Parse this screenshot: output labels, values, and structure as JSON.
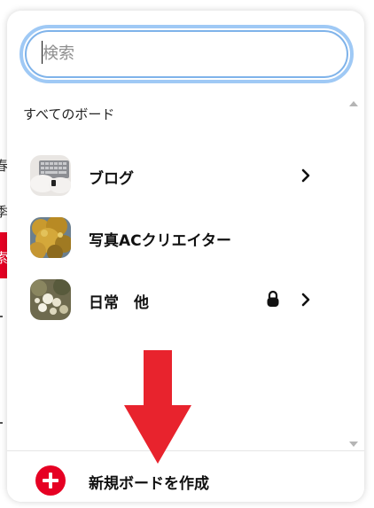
{
  "search": {
    "placeholder": "検索",
    "value": ""
  },
  "boards": {
    "section_label": "すべてのボード",
    "items": [
      {
        "name": "ブログ",
        "thumb": "keyboard-photo-thumbnail",
        "locked": false,
        "has_chevron": true
      },
      {
        "name": "写真ACクリエイター",
        "thumb": "autumn-leaves-thumbnail",
        "locked": false,
        "has_chevron": false
      },
      {
        "name": "日常　他",
        "thumb": "flowers-thumbnail",
        "locked": true,
        "has_chevron": true
      }
    ]
  },
  "footer": {
    "create_label": "新規ボードを作成",
    "create_icon": "plus-circle-icon"
  },
  "background_page": {
    "glyphs": [
      "春",
      "季",
      "索"
    ]
  },
  "colors": {
    "brand_red": "#e60023",
    "focus_ring": "#9fc9f5",
    "annotation_arrow": "#e8232d"
  }
}
